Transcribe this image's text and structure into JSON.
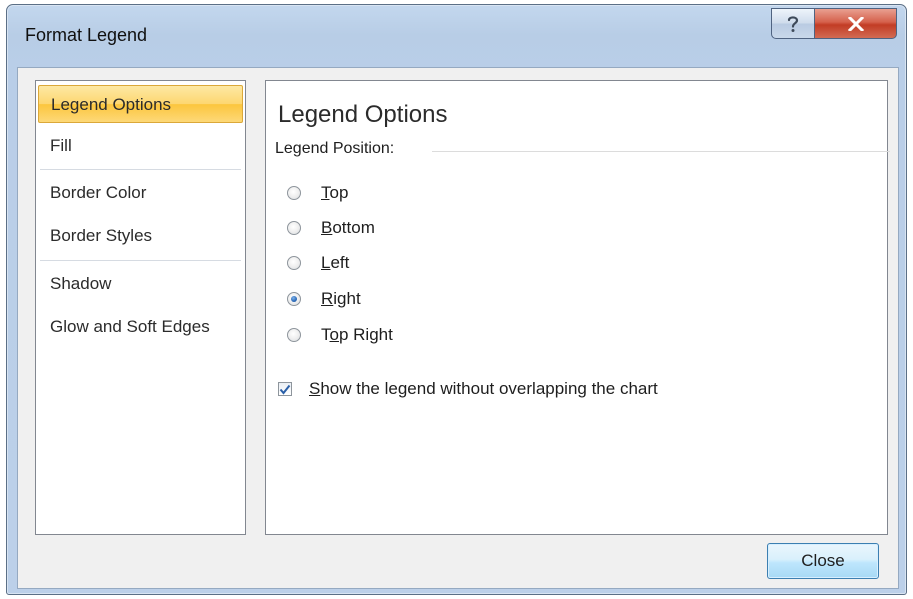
{
  "window": {
    "title": "Format Legend"
  },
  "caption_buttons": {
    "help_icon": "question-mark-icon",
    "close_icon": "close-x-icon"
  },
  "sidebar": {
    "items": [
      {
        "label": "Legend Options",
        "selected": true
      },
      {
        "label": "Fill",
        "selected": false
      },
      {
        "label": "Border Color",
        "selected": false
      },
      {
        "label": "Border Styles",
        "selected": false
      },
      {
        "label": "Shadow",
        "selected": false
      },
      {
        "label": "Glow and Soft Edges",
        "selected": false
      }
    ]
  },
  "panel": {
    "heading": "Legend Options",
    "group_label": "Legend Position:",
    "positions": [
      {
        "pre": "",
        "accel": "T",
        "post": "op",
        "checked": false
      },
      {
        "pre": "",
        "accel": "B",
        "post": "ottom",
        "checked": false
      },
      {
        "pre": "",
        "accel": "L",
        "post": "eft",
        "checked": false
      },
      {
        "pre": "",
        "accel": "R",
        "post": "ight",
        "checked": true
      },
      {
        "pre": "T",
        "accel": "o",
        "post": "p Right",
        "checked": false
      }
    ],
    "overlap_checkbox": {
      "accel": "S",
      "post": "how the legend without overlapping the chart",
      "checked": true
    }
  },
  "footer": {
    "close_label": "Close"
  },
  "colors": {
    "selection": "#fcc63d",
    "accent_blue": "#2a69b8",
    "close_button_red": "#c23c25"
  }
}
